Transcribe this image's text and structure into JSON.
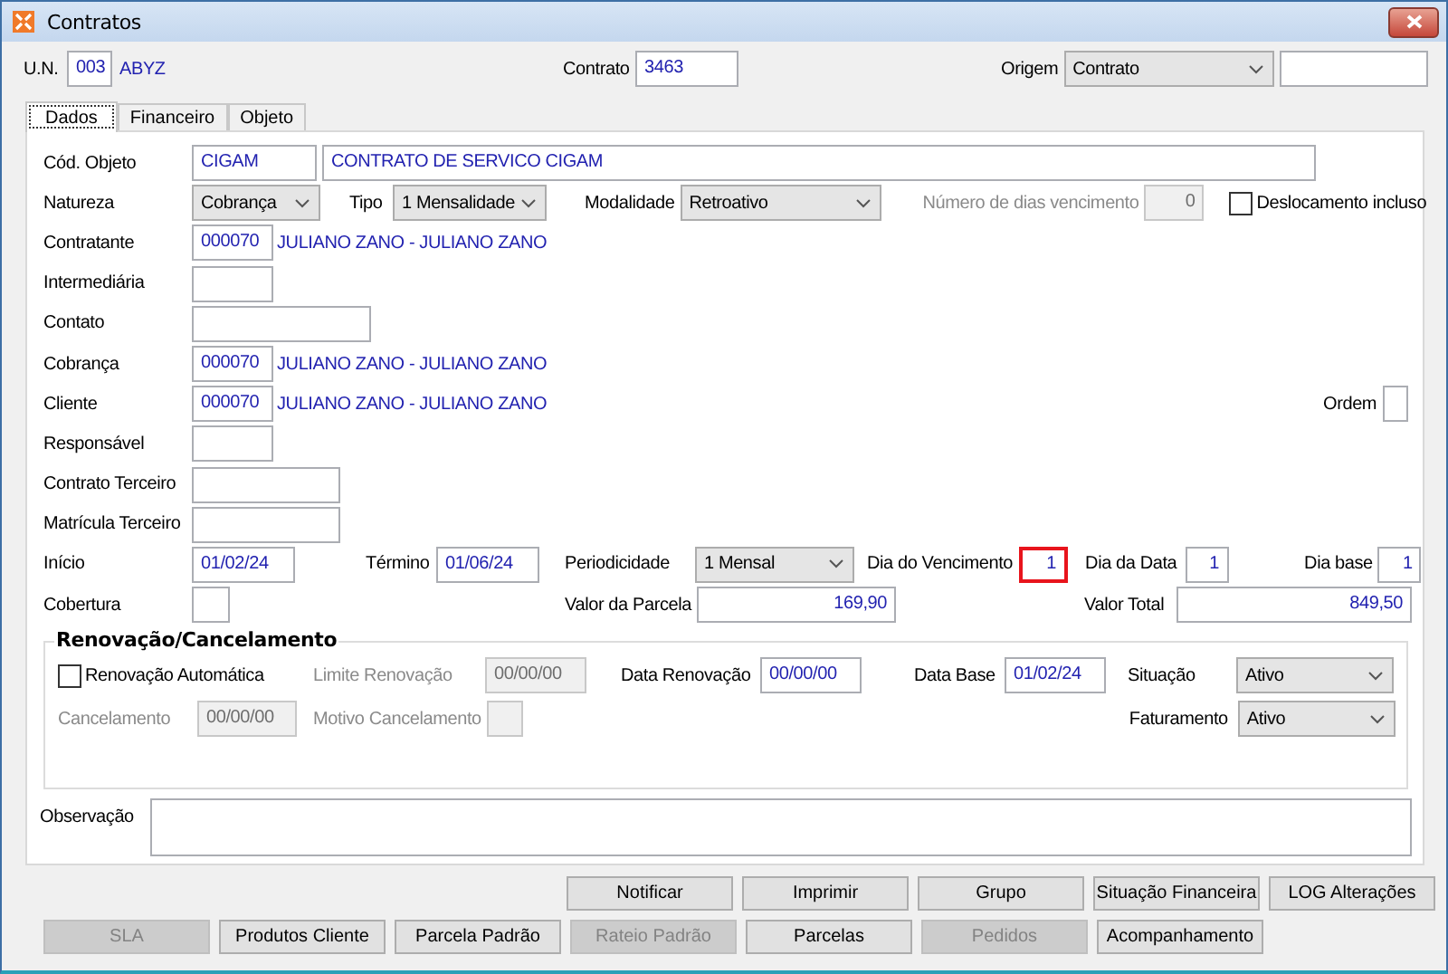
{
  "window": {
    "title": "Contratos"
  },
  "header": {
    "items": [
      {
        "kind": "label",
        "text": "U.N.",
        "disabled": false
      },
      {
        "kind": "field",
        "value": "003",
        "disabled": false
      },
      {
        "kind": "name",
        "text": "ABYZ"
      },
      {
        "kind": "label",
        "text": "Contrato",
        "disabled": false
      },
      {
        "kind": "field",
        "value": "3463",
        "disabled": false
      },
      {
        "kind": "label",
        "text": "Origem",
        "disabled": false
      },
      {
        "kind": "select",
        "value": "Contrato"
      },
      {
        "kind": "field",
        "disabled": false
      }
    ]
  },
  "tabs": [
    {
      "label": "Dados",
      "selected": true
    },
    {
      "label": "Financeiro",
      "selected": false
    },
    {
      "label": "Objeto",
      "selected": false
    }
  ],
  "form": {
    "rows": [
      {
        "items": [
          {
            "kind": "label",
            "text": "Cód. Objeto",
            "disabled": false
          },
          {
            "kind": "field",
            "value": "CIGAM",
            "disabled": false
          },
          {
            "kind": "field",
            "value": "CONTRATO DE SERVICO CIGAM",
            "disabled": false
          }
        ]
      },
      {
        "items": [
          {
            "kind": "label",
            "text": "Natureza",
            "disabled": false
          },
          {
            "kind": "select",
            "value": "Cobrança"
          },
          {
            "kind": "label",
            "text": "Tipo",
            "disabled": false
          },
          {
            "kind": "select",
            "value": "1 Mensalidade"
          },
          {
            "kind": "label",
            "text": "Modalidade",
            "disabled": false
          },
          {
            "kind": "select",
            "value": "Retroativo"
          },
          {
            "kind": "label",
            "text": "Número de dias vencimento",
            "disabled": true
          },
          {
            "kind": "field",
            "value": "0",
            "disabled": true
          },
          {
            "kind": "check",
            "label": "Deslocamento incluso",
            "checked": false
          }
        ]
      },
      {
        "items": [
          {
            "kind": "label",
            "text": "Contratante",
            "disabled": false
          },
          {
            "kind": "field",
            "value": "000070",
            "disabled": false
          },
          {
            "kind": "name",
            "text": "JULIANO ZANO - JULIANO ZANO"
          }
        ]
      },
      {
        "items": [
          {
            "kind": "label",
            "text": "Intermediária",
            "disabled": false
          },
          {
            "kind": "field",
            "disabled": false
          }
        ]
      },
      {
        "items": [
          {
            "kind": "label",
            "text": "Contato",
            "disabled": false
          },
          {
            "kind": "field",
            "disabled": false
          }
        ]
      },
      {
        "items": [
          {
            "kind": "label",
            "text": "Cobrança",
            "disabled": false
          },
          {
            "kind": "field",
            "value": "000070",
            "disabled": false
          },
          {
            "kind": "name",
            "text": "JULIANO ZANO - JULIANO ZANO"
          }
        ]
      },
      {
        "items": [
          {
            "kind": "label",
            "text": "Cliente",
            "disabled": false
          },
          {
            "kind": "field",
            "value": "000070",
            "disabled": false
          },
          {
            "kind": "name",
            "text": "JULIANO ZANO - JULIANO ZANO"
          },
          {
            "kind": "label",
            "text": "Ordem",
            "disabled": false
          },
          {
            "kind": "field",
            "disabled": false
          }
        ]
      },
      {
        "items": [
          {
            "kind": "label",
            "text": "Responsável",
            "disabled": false
          },
          {
            "kind": "field",
            "disabled": false
          }
        ]
      },
      {
        "items": [
          {
            "kind": "label",
            "text": "Contrato Terceiro",
            "disabled": false
          },
          {
            "kind": "field",
            "disabled": false
          }
        ]
      },
      {
        "items": [
          {
            "kind": "label",
            "text": "Matrícula Terceiro",
            "disabled": false
          },
          {
            "kind": "field",
            "disabled": false
          }
        ]
      },
      {
        "items": [
          {
            "kind": "label",
            "text": "Início",
            "disabled": false
          },
          {
            "kind": "field",
            "value": "01/02/24",
            "disabled": false
          },
          {
            "kind": "label",
            "text": "Término",
            "disabled": false
          },
          {
            "kind": "field",
            "value": "01/06/24",
            "disabled": false
          },
          {
            "kind": "label",
            "text": "Periodicidade",
            "disabled": false
          },
          {
            "kind": "select",
            "value": "1 Mensal"
          },
          {
            "kind": "label",
            "text": "Dia do Vencimento",
            "disabled": false
          },
          {
            "kind": "field",
            "value": "1",
            "disabled": false,
            "highlighted": true
          },
          {
            "kind": "label",
            "text": "Dia da Data",
            "disabled": false
          },
          {
            "kind": "field",
            "value": "1",
            "disabled": false
          },
          {
            "kind": "label",
            "text": "Dia base",
            "disabled": false
          },
          {
            "kind": "field",
            "value": "1",
            "disabled": false
          }
        ]
      },
      {
        "items": [
          {
            "kind": "label",
            "text": "Cobertura",
            "disabled": false
          },
          {
            "kind": "field",
            "disabled": false
          },
          {
            "kind": "label",
            "text": "Valor da Parcela",
            "disabled": false
          },
          {
            "kind": "field",
            "value": "169,90",
            "disabled": false
          },
          {
            "kind": "label",
            "text": "Valor Total",
            "disabled": false
          },
          {
            "kind": "field",
            "value": "849,50",
            "disabled": false
          }
        ]
      }
    ]
  },
  "renewal": {
    "title": "Renovação/Cancelamento",
    "rows": [
      {
        "items": [
          {
            "kind": "check",
            "label": "Renovação Automática",
            "checked": false
          },
          {
            "kind": "label",
            "text": "Limite Renovação",
            "disabled": true
          },
          {
            "kind": "field",
            "value": "00/00/00",
            "disabled": true
          },
          {
            "kind": "label",
            "text": "Data Renovação",
            "disabled": false
          },
          {
            "kind": "field",
            "value": "00/00/00",
            "disabled": false
          },
          {
            "kind": "label",
            "text": "Data Base",
            "disabled": false
          },
          {
            "kind": "field",
            "value": "01/02/24",
            "disabled": false
          },
          {
            "kind": "label",
            "text": "Situação",
            "disabled": false
          },
          {
            "kind": "select",
            "value": "Ativo"
          }
        ]
      },
      {
        "items": [
          {
            "kind": "label",
            "text": "Cancelamento",
            "disabled": true
          },
          {
            "kind": "field",
            "value": "00/00/00",
            "disabled": true
          },
          {
            "kind": "label",
            "text": "Motivo Cancelamento",
            "disabled": true
          },
          {
            "kind": "field",
            "disabled": true
          },
          {
            "kind": "label",
            "text": "Faturamento",
            "disabled": false
          },
          {
            "kind": "select",
            "value": "Ativo"
          }
        ]
      }
    ]
  },
  "observation": {
    "label": "Observação"
  },
  "buttons": [
    [
      {
        "label": "Notificar",
        "disabled": false
      },
      {
        "label": "Imprimir",
        "disabled": false
      },
      {
        "label": "Grupo",
        "disabled": false
      },
      {
        "label": "Situação Financeira",
        "disabled": false
      },
      {
        "label": "LOG Alterações",
        "disabled": false
      }
    ],
    [
      {
        "label": "SLA",
        "disabled": true
      },
      {
        "label": "Produtos Cliente",
        "disabled": false
      },
      {
        "label": "Parcela Padrão",
        "disabled": false
      },
      {
        "label": "Rateio Padrão",
        "disabled": true
      },
      {
        "label": "Parcelas",
        "disabled": false
      },
      {
        "label": "Pedidos",
        "disabled": true
      },
      {
        "label": "Acompanhamento",
        "disabled": false
      }
    ]
  ]
}
